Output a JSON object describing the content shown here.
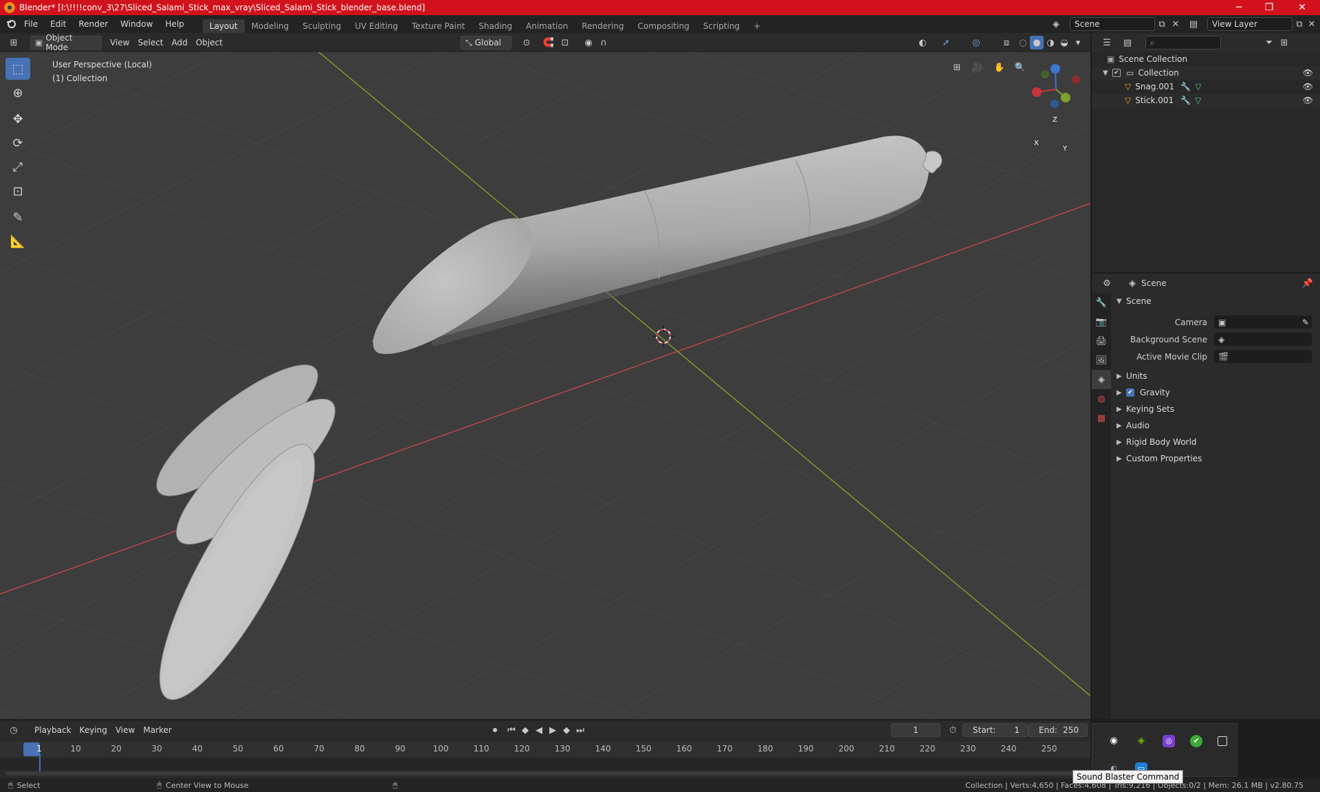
{
  "window": {
    "title": "Blender* [I:\\!!!!conv_3\\27\\Sliced_Salami_Stick_max_vray\\Sliced_Salami_Stick_blender_base.blend]",
    "minimize_glyph": "─",
    "restore_glyph": "❐",
    "close_glyph": "✕"
  },
  "menu": {
    "items": [
      "File",
      "Edit",
      "Render",
      "Window",
      "Help"
    ],
    "workspaces": [
      "Layout",
      "Modeling",
      "Sculpting",
      "UV Editing",
      "Texture Paint",
      "Shading",
      "Animation",
      "Rendering",
      "Compositing",
      "Scripting"
    ],
    "active_workspace": "Layout",
    "add_tab": "+",
    "scene": "Scene",
    "view_layer": "View Layer"
  },
  "viewport_header": {
    "mode": "Object Mode",
    "menus": [
      "View",
      "Select",
      "Add",
      "Object"
    ],
    "orientation": "Global"
  },
  "viewport": {
    "perspective": "User Perspective (Local)",
    "collection": "(1) Collection",
    "gizmo": {
      "x": "X",
      "y": "Y",
      "z": "Z"
    }
  },
  "outliner": {
    "search_placeholder": "",
    "root": "Scene Collection",
    "collection": "Collection",
    "objects": [
      "Snag.001",
      "Stick.001"
    ]
  },
  "properties": {
    "context": "Scene",
    "section": "Scene",
    "fields": [
      {
        "label": "Camera",
        "value": ""
      },
      {
        "label": "Background Scene",
        "value": ""
      },
      {
        "label": "Active Movie Clip",
        "value": ""
      }
    ],
    "subsections": [
      "Units",
      "Gravity",
      "Keying Sets",
      "Audio",
      "Rigid Body World",
      "Custom Properties"
    ],
    "gravity_enabled": true
  },
  "timeline": {
    "menus": [
      "Playback",
      "Keying",
      "View",
      "Marker"
    ],
    "current_frame": "1",
    "start_label": "Start:",
    "start": "1",
    "end_label": "End:",
    "end": "250",
    "ticks": [
      "1",
      "10",
      "20",
      "30",
      "40",
      "50",
      "60",
      "70",
      "80",
      "90",
      "100",
      "110",
      "120",
      "130",
      "140",
      "150",
      "160",
      "170",
      "180",
      "190",
      "200",
      "210",
      "220",
      "230",
      "240",
      "250"
    ]
  },
  "status": {
    "left": "Select",
    "middle": "Center View to Mouse",
    "right": "Collection | Verts:4,650 | Faces:4,608 | Tris:9,216 | Objects:0/2 | Mem: 26.1 MB | v2.80.75"
  },
  "tray": {
    "tooltip": "Sound Blaster Command"
  },
  "colors": {
    "title_bar": "#d1121c",
    "accent": "#4772b3",
    "x_axis": "#c8363b",
    "y_axis": "#7ea02f",
    "z_axis": "#3b76d2"
  }
}
